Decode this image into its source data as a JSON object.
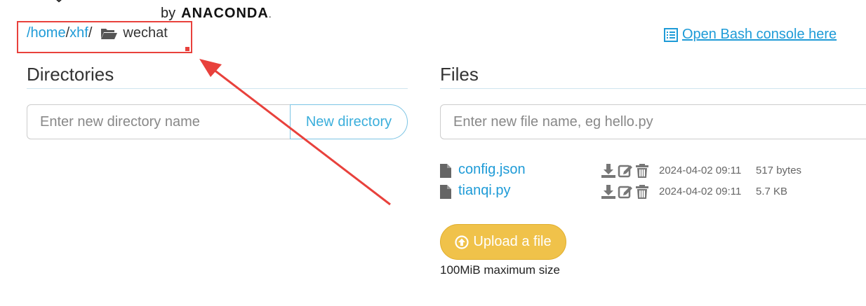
{
  "header": {
    "by_text": "by",
    "brand": "ANACONDA",
    "brand_suffix": "."
  },
  "breadcrumb": {
    "parts": [
      "/home",
      "/",
      "xhf",
      "/"
    ],
    "current": "wechat"
  },
  "bash_link": "Open Bash console here",
  "directories": {
    "heading": "Directories",
    "input_placeholder": "Enter new directory name",
    "button_label": "New directory"
  },
  "files": {
    "heading": "Files",
    "input_placeholder": "Enter new file name, eg hello.py",
    "rows": [
      {
        "name": "config.json",
        "date": "2024-04-02 09:11",
        "size": "517 bytes"
      },
      {
        "name": "tianqi.py",
        "date": "2024-04-02 09:11",
        "size": "5.7 KB"
      }
    ],
    "upload_label": "Upload a file",
    "upload_note": "100MiB maximum size"
  },
  "colors": {
    "link": "#1e9bd7",
    "highlight": "#e8413c",
    "upload": "#f0c24a"
  },
  "icons": [
    "folder-open-icon",
    "terminal-list-icon",
    "file-icon",
    "download-icon",
    "edit-icon",
    "trash-icon",
    "upload-circle-icon"
  ]
}
